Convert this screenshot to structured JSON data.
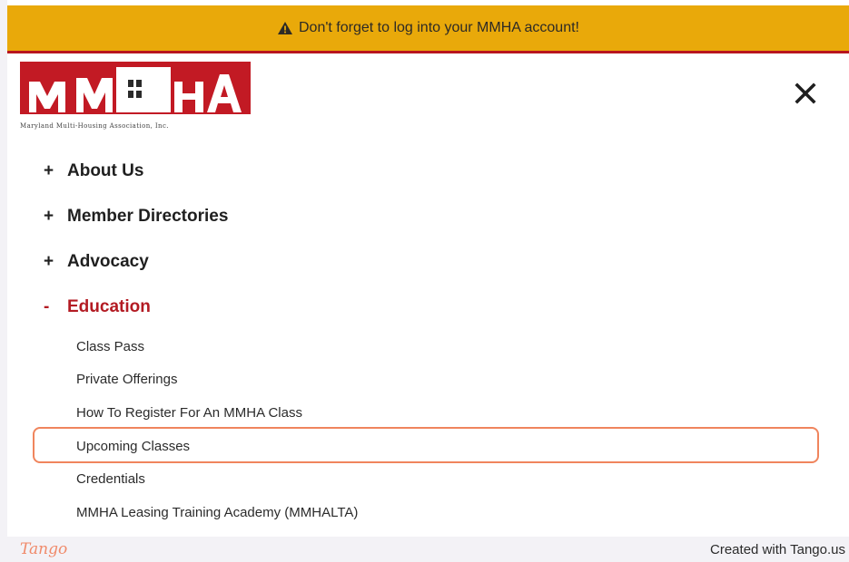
{
  "banner": {
    "icon": "warning-icon",
    "text": "Don't forget to log into your MMHA account!",
    "background": "#e9a90a",
    "accent": "#b8161e"
  },
  "logo": {
    "letters": "MMHA",
    "tagline": "Maryland Multi-Housing Association, Inc.",
    "color": "#c21a24"
  },
  "close_icon": "close-icon",
  "menu": {
    "items": [
      {
        "sign": "+",
        "label": "About Us"
      },
      {
        "sign": "+",
        "label": "Member Directories"
      },
      {
        "sign": "+",
        "label": "Advocacy"
      },
      {
        "sign": "-",
        "label": "Education"
      }
    ],
    "active_color": "#b31b23",
    "education_subitems": [
      "Class Pass",
      "Private Offerings",
      "How To Register For An MMHA Class",
      "Upcoming Classes",
      "Credentials",
      "MMHA Leasing Training Academy (MMHALTA)"
    ],
    "highlighted_subitem": "Upcoming Classes",
    "highlight_color": "#f0855d"
  },
  "footer": {
    "brand": "Tango",
    "credit": "Created with Tango.us"
  }
}
